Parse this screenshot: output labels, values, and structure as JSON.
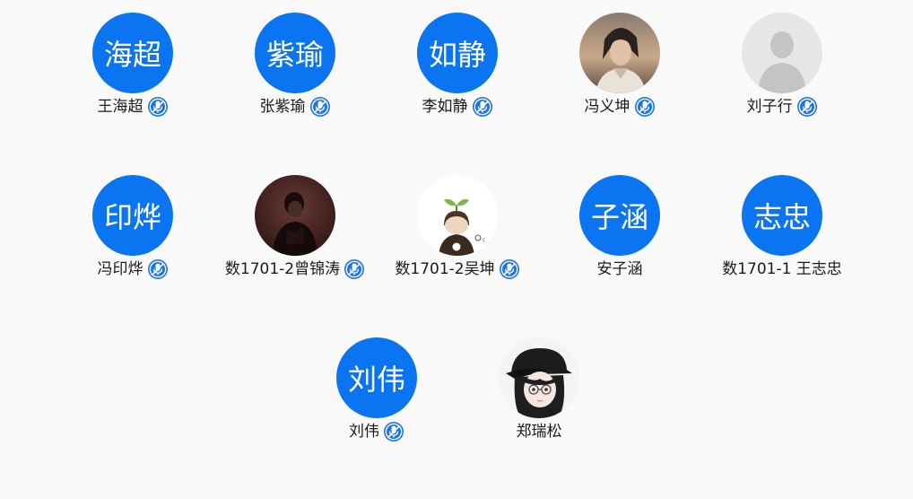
{
  "members": [
    {
      "initials": "海超",
      "name": "王海超",
      "avatar_type": "text",
      "muted_icon": "mic-muted-icon",
      "muted": true
    },
    {
      "initials": "紫瑜",
      "name": "张紫瑜",
      "avatar_type": "text",
      "muted_icon": "mic-muted-icon",
      "muted": true
    },
    {
      "initials": "如静",
      "name": "李如静",
      "avatar_type": "text",
      "muted_icon": "mic-muted-icon",
      "muted": true
    },
    {
      "initials": "",
      "name": "冯义坤",
      "avatar_type": "photo-portrait",
      "muted_icon": "mic-muted-icon",
      "muted": true
    },
    {
      "initials": "",
      "name": "刘子行",
      "avatar_type": "default-silhouette",
      "muted_icon": "mic-muted-icon",
      "muted": true
    },
    {
      "initials": "印烨",
      "name": "冯印烨",
      "avatar_type": "text",
      "muted_icon": "mic-muted-icon",
      "muted": true
    },
    {
      "initials": "",
      "name": "数1701-2曾锦涛",
      "avatar_type": "photo-dark-figure",
      "muted_icon": "mic-muted-icon",
      "muted": true
    },
    {
      "initials": "",
      "name": "数1701-2吴坤",
      "avatar_type": "cartoon-sprout",
      "muted_icon": "mic-muted-icon",
      "muted": true
    },
    {
      "initials": "子涵",
      "name": "安子涵",
      "avatar_type": "text",
      "muted": false
    },
    {
      "initials": "志忠",
      "name": "数1701-1 王志忠",
      "avatar_type": "text",
      "muted": false
    },
    {
      "initials": "刘伟",
      "name": "刘伟",
      "avatar_type": "text",
      "muted_icon": "mic-muted-icon",
      "muted": true
    },
    {
      "initials": "",
      "name": "郑瑞松",
      "avatar_type": "anime-girl-cap",
      "muted": false
    }
  ],
  "colors": {
    "avatar_blue": "#0b74f0",
    "background": "#f9f9fa",
    "badge_blue": "#1a73e8"
  }
}
